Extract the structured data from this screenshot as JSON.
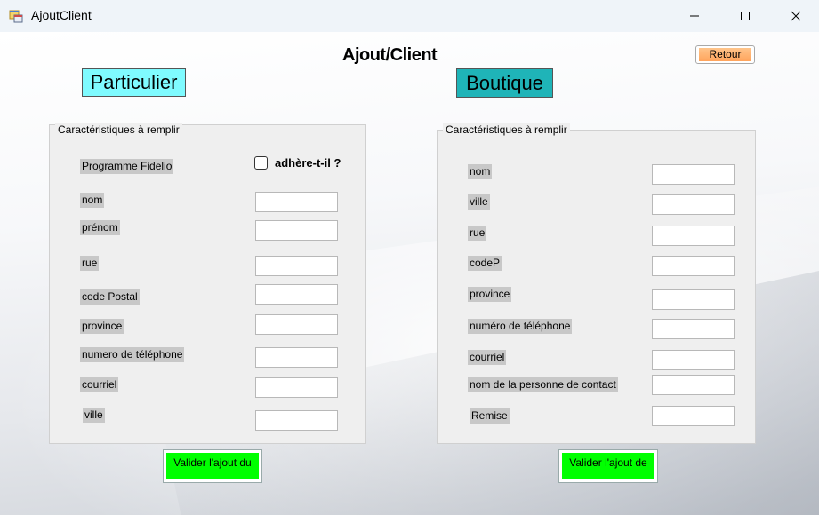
{
  "window": {
    "title": "AjoutClient",
    "icon": "app-form-icon",
    "controls": [
      "minimize-icon",
      "maximize-icon",
      "close-icon"
    ]
  },
  "header": {
    "title": "Ajout/Client",
    "back_label": "Retour"
  },
  "tabs": {
    "particulier": "Particulier",
    "boutique": "Boutique"
  },
  "particulier": {
    "group_title": "Caractéristiques à remplir",
    "fidelio_label": "Programme Fidelio",
    "checkbox_label": "adhère-t-il ?",
    "checkbox_checked": false,
    "fields": [
      {
        "label": "nom",
        "value": ""
      },
      {
        "label": "prénom",
        "value": ""
      },
      {
        "label": "rue",
        "value": ""
      },
      {
        "label": "code Postal",
        "value": ""
      },
      {
        "label": "province",
        "value": ""
      },
      {
        "label": "numero de téléphone",
        "value": ""
      },
      {
        "label": "courriel",
        "value": ""
      },
      {
        "label": "ville",
        "value": ""
      }
    ],
    "submit_label": "Valider l'ajout du"
  },
  "boutique": {
    "group_title": "Caractéristiques à remplir",
    "fields": [
      {
        "label": "nom",
        "value": ""
      },
      {
        "label": "ville",
        "value": ""
      },
      {
        "label": "rue",
        "value": ""
      },
      {
        "label": "codeP",
        "value": ""
      },
      {
        "label": "province",
        "value": ""
      },
      {
        "label": "numéro de téléphone",
        "value": ""
      },
      {
        "label": "courriel",
        "value": ""
      },
      {
        "label": "nom de la personne de contact",
        "value": ""
      },
      {
        "label": "Remise",
        "value": ""
      }
    ],
    "submit_label": "Valider l'ajout de"
  },
  "colors": {
    "particulier_tab": "#7ffbff",
    "boutique_tab": "#1fb4b8",
    "submit_button": "#00ff00",
    "retour_button": "#ffb06c"
  }
}
